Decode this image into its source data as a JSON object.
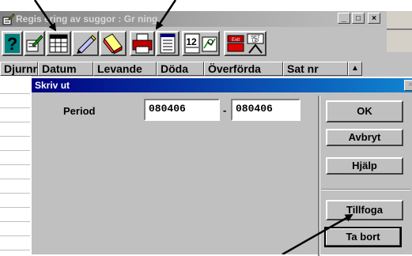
{
  "main_window": {
    "title": "Registrering av suggor : Grisning",
    "title_visible": "Regis  ering av suggor : Gr   ning",
    "controls": {
      "minimize": "_",
      "maximize": "□",
      "close": "×"
    }
  },
  "toolbar": {
    "buttons": [
      {
        "icon": "help-question-icon"
      },
      {
        "icon": "edit-pencil-icon"
      },
      {
        "icon": "calendar-grid-icon"
      },
      {
        "icon": "pencil-eraser-icon"
      },
      {
        "icon": "eraser-delete-icon"
      },
      {
        "icon": "printer-icon"
      },
      {
        "icon": "document-list-icon"
      },
      {
        "icon": "calendar-date-icon"
      },
      {
        "icon": "chart-view-icon"
      },
      {
        "icon": "exit-door-icon"
      },
      {
        "icon": "setup-tools-icon"
      }
    ],
    "calendar_text": "12",
    "setup_text": "SET UP",
    "exit_text": "Exit"
  },
  "grid": {
    "columns": [
      "Djurnr",
      "Datum",
      "Levande",
      "Döda",
      "Överförda",
      "Sat nr"
    ]
  },
  "dialog": {
    "title": "Skriv ut",
    "period_label": "Period",
    "period_from": "080406",
    "separator": "-",
    "period_to": "080406",
    "buttons": {
      "ok": "OK",
      "cancel": "Avbryt",
      "help": "Hjälp",
      "add": "Tillfoga",
      "remove": "Ta bort"
    }
  },
  "colors": {
    "dialog_title": "#000080",
    "face": "#c0c0c0",
    "window_bg": "#ffffff"
  }
}
